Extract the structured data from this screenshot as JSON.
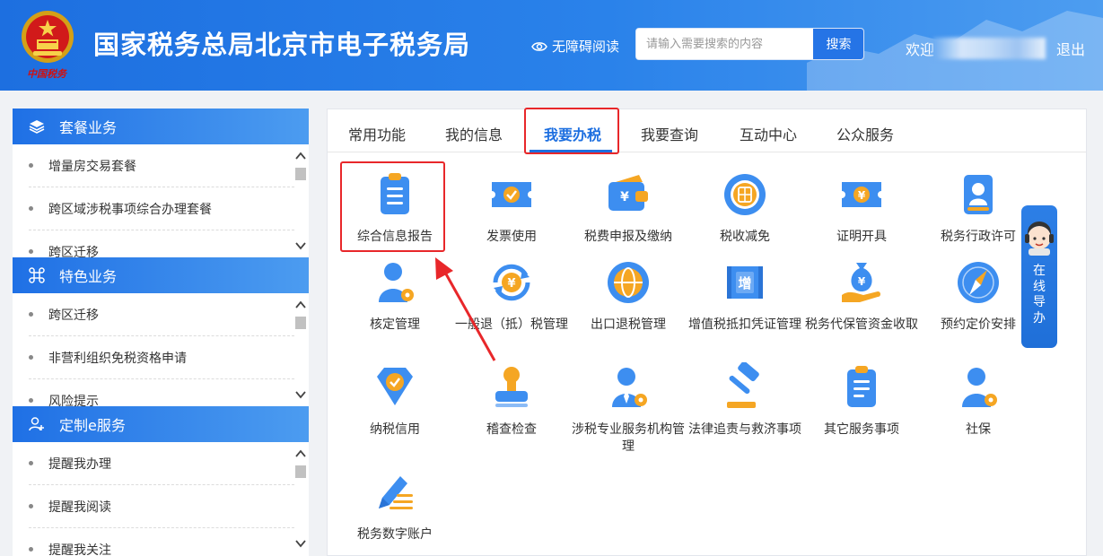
{
  "header": {
    "title": "国家税务总局北京市电子税务局",
    "slogan": "中国税务",
    "accessibility_label": "无障碍阅读",
    "search": {
      "placeholder": "请输入需要搜索的内容",
      "button_label": "搜索"
    },
    "welcome_label": "欢迎",
    "logout_label": "退出"
  },
  "sidebar": {
    "sections": [
      {
        "title": "套餐业务",
        "icon": "layers-icon",
        "items": [
          "增量房交易套餐",
          "跨区域涉税事项综合办理套餐",
          "跨区迁移"
        ]
      },
      {
        "title": "特色业务",
        "icon": "command-icon",
        "items": [
          "跨区迁移",
          "非营利组织免税资格申请",
          "风险提示"
        ]
      },
      {
        "title": "定制e服务",
        "icon": "user-add-icon",
        "items": [
          "提醒我办理",
          "提醒我阅读",
          "提醒我关注"
        ]
      }
    ]
  },
  "tabs": [
    "常用功能",
    "我的信息",
    "我要办税",
    "我要查询",
    "互动中心",
    "公众服务"
  ],
  "active_tab": "我要办税",
  "services": [
    {
      "label": "综合信息报告",
      "icon": "document-list-icon"
    },
    {
      "label": "发票使用",
      "icon": "ticket-check-icon"
    },
    {
      "label": "税费申报及缴纳",
      "icon": "wallet-yen-icon"
    },
    {
      "label": "税收减免",
      "icon": "coin-stack-icon"
    },
    {
      "label": "证明开具",
      "icon": "ticket-yen-icon"
    },
    {
      "label": "税务行政许可",
      "icon": "id-badge-icon"
    },
    {
      "label": "核定管理",
      "icon": "user-gear-icon"
    },
    {
      "label": "一般退（抵）税管理",
      "icon": "refund-yen-icon"
    },
    {
      "label": "出口退税管理",
      "icon": "globe-icon"
    },
    {
      "label": "增值税抵扣凭证管理",
      "icon": "vat-ticket-icon"
    },
    {
      "label": "税务代保管资金收取",
      "icon": "money-bag-hand-icon"
    },
    {
      "label": "预约定价安排",
      "icon": "compass-icon"
    },
    {
      "label": "纳税信用",
      "icon": "diamond-check-icon"
    },
    {
      "label": "稽查检查",
      "icon": "stamp-icon"
    },
    {
      "label": "涉税专业服务机构管理",
      "icon": "agent-gear-icon"
    },
    {
      "label": "法律追责与救济事项",
      "icon": "gavel-icon"
    },
    {
      "label": "其它服务事项",
      "icon": "clipboard-icon"
    },
    {
      "label": "社保",
      "icon": "user-gear-icon"
    },
    {
      "label": "税务数字账户",
      "icon": "pen-lines-icon"
    }
  ],
  "guide": {
    "label": "在线导办",
    "icon": "headset-avatar-icon"
  },
  "colors": {
    "primary": "#1d6fe0",
    "highlight": "#e8272a",
    "icon_blue": "#3d8ef0",
    "icon_orange": "#f5a623"
  }
}
